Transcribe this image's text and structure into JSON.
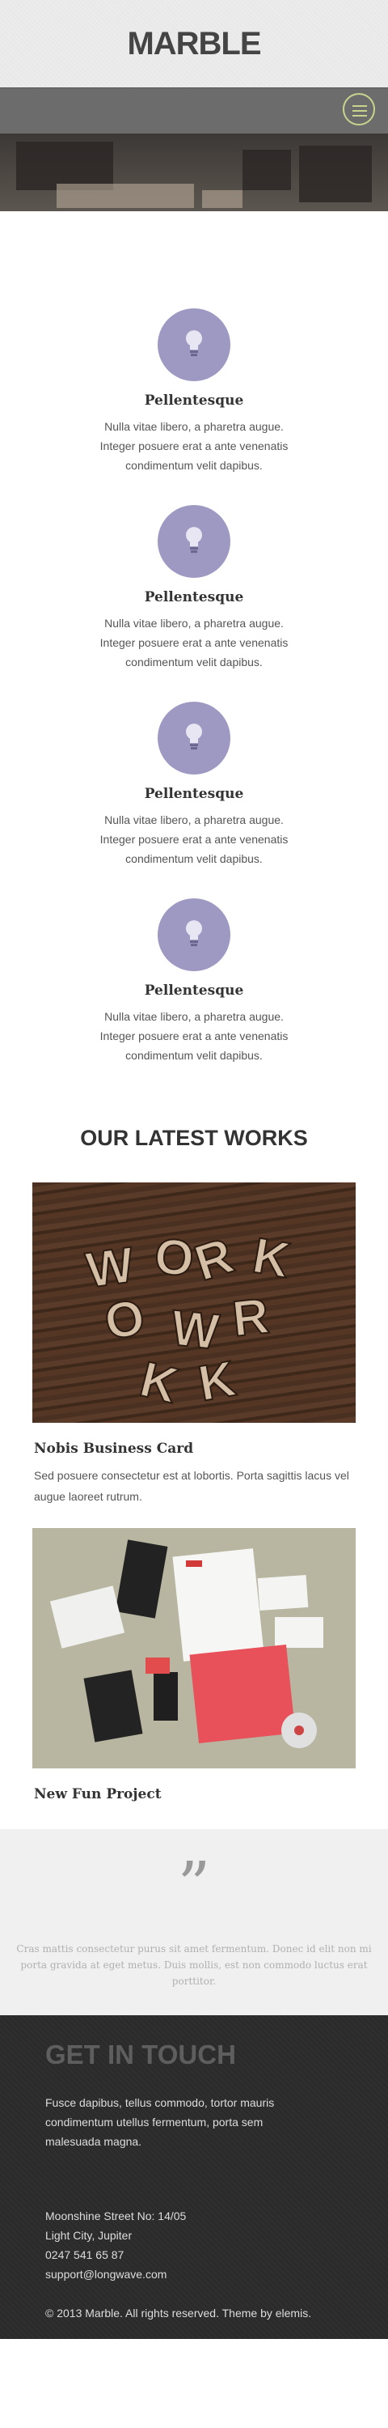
{
  "header": {
    "logo": "MARBLE"
  },
  "features": [
    {
      "title": "Pellentesque",
      "text": "Nulla vitae  libero, a pharetra augue. Integer posuere erat a ante venenatis condimentum velit dapibus."
    },
    {
      "title": "Pellentesque",
      "text": "Nulla vitae  libero, a pharetra augue. Integer posuere erat a ante venenatis condimentum velit dapibus."
    },
    {
      "title": "Pellentesque",
      "text": "Nulla vitae  libero, a pharetra augue. Integer posuere erat a ante venenatis condimentum velit dapibus."
    },
    {
      "title": "Pellentesque",
      "text": "Nulla vitae  libero, a pharetra augue. Integer posuere erat a ante venenatis condimentum velit dapibus."
    }
  ],
  "works": {
    "title": "OUR LATEST WORKS",
    "items": [
      {
        "title": "Nobis Business Card",
        "text": "Sed posuere consectetur est at lobortis. Porta sagittis lacus vel augue laoreet rutrum.",
        "image_letters": "WORK"
      },
      {
        "title": "New Fun Project",
        "text": ""
      }
    ]
  },
  "quote": {
    "mark": "”",
    "text": "Cras mattis consectetur purus sit amet fermentum. Donec id elit non mi porta gravida at eget metus. Duis mollis, est non commodo luctus erat porttitor."
  },
  "contact": {
    "title": "GET IN TOUCH",
    "intro": "Fusce dapibus, tellus commodo, tortor mauris condimentum utellus fermentum, porta sem malesuada magna.",
    "address": [
      "Moonshine Street No: 14/05",
      "Light City, Jupiter",
      "0247 541 65 87",
      "support@longwave.com"
    ],
    "copyright": "© 2013 Marble. All rights reserved. Theme by elemis."
  },
  "colors": {
    "accent_circle": "#9e99c2",
    "menu_button": "#c9d38d",
    "footer": "#2b2b2b"
  },
  "icons": {
    "feature": "lightbulb-icon",
    "menu": "hamburger-menu-icon",
    "quote": "quote-mark-icon"
  }
}
